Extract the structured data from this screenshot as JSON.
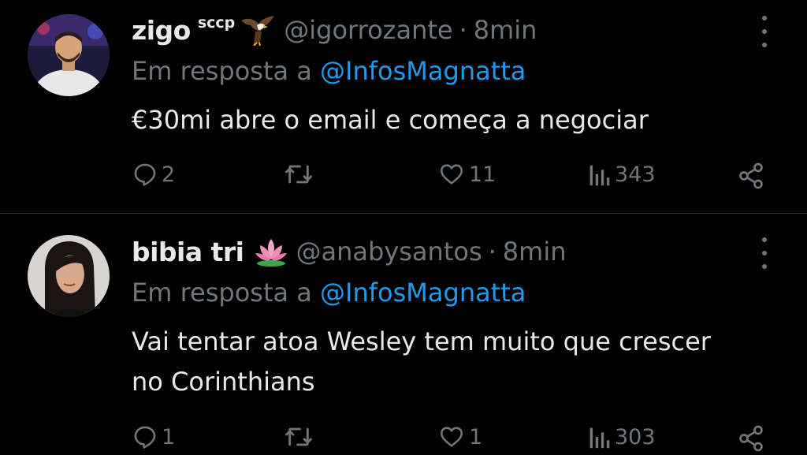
{
  "tweets": [
    {
      "display_name": "zigo",
      "name_suffix": "sccp",
      "badge_icon": "eagle-emoji",
      "handle": "@igorrozante",
      "separator": "·",
      "time": "8min",
      "reply_prefix": "Em resposta a",
      "reply_to": "@InfosMagnatta",
      "text": "€30mi abre o email e começa a negociar",
      "replies": "2",
      "retweets": "",
      "likes": "11",
      "views": "343"
    },
    {
      "display_name": "bibia tri",
      "name_suffix": "",
      "badge_icon": "lotus-emoji",
      "handle": "@anabysantos",
      "separator": "·",
      "time": "8min",
      "reply_prefix": "Em resposta a",
      "reply_to": "@InfosMagnatta",
      "text": "Vai tentar atoa Wesley tem muito que crescer\nno Corinthians",
      "replies": "1",
      "retweets": "",
      "likes": "1",
      "views": "303"
    }
  ],
  "colors": {
    "background": "#000000",
    "primary_text": "#e7e9ea",
    "secondary_text": "#71767b",
    "link": "#1d9bf0",
    "divider": "#2f3336"
  }
}
